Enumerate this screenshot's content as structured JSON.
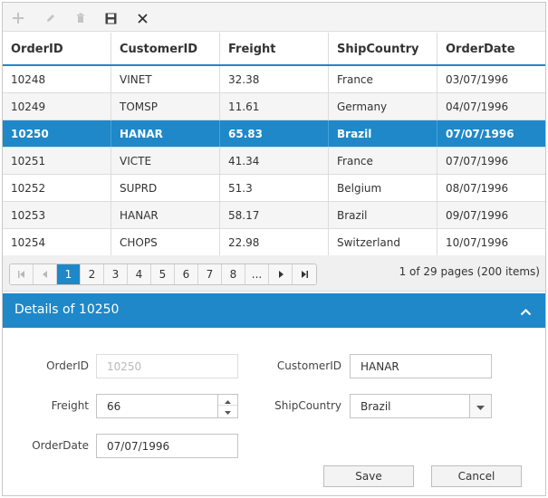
{
  "toolbar": {
    "add_icon": "plus-icon",
    "edit_icon": "pencil-icon",
    "delete_icon": "trash-icon",
    "update_icon": "save-icon",
    "cancel_icon": "close-icon"
  },
  "columns": [
    "OrderID",
    "CustomerID",
    "Freight",
    "ShipCountry",
    "OrderDate"
  ],
  "rows": [
    [
      "10248",
      "VINET",
      "32.38",
      "France",
      "03/07/1996"
    ],
    [
      "10249",
      "TOMSP",
      "11.61",
      "Germany",
      "04/07/1996"
    ],
    [
      "10250",
      "HANAR",
      "65.83",
      "Brazil",
      "07/07/1996"
    ],
    [
      "10251",
      "VICTE",
      "41.34",
      "France",
      "07/07/1996"
    ],
    [
      "10252",
      "SUPRD",
      "51.3",
      "Belgium",
      "08/07/1996"
    ],
    [
      "10253",
      "HANAR",
      "58.17",
      "Brazil",
      "09/07/1996"
    ],
    [
      "10254",
      "CHOPS",
      "22.98",
      "Switzerland",
      "10/07/1996"
    ]
  ],
  "selected_row": 2,
  "pager": {
    "pages": [
      "1",
      "2",
      "3",
      "4",
      "5",
      "6",
      "7",
      "8",
      "..."
    ],
    "current": "1",
    "info": "1 of 29 pages (200 items)"
  },
  "details": {
    "title": "Details of 10250",
    "fields": {
      "order_id": {
        "label": "OrderID",
        "value": "10250"
      },
      "customer_id": {
        "label": "CustomerID",
        "value": "HANAR"
      },
      "freight": {
        "label": "Freight",
        "value": "66"
      },
      "ship_country": {
        "label": "ShipCountry",
        "value": "Brazil"
      },
      "order_date": {
        "label": "OrderDate",
        "value": "07/07/1996"
      }
    },
    "save_label": "Save",
    "cancel_label": "Cancel"
  },
  "colors": {
    "accent": "#1e88c9",
    "selected_text": "#ffffff",
    "toolbar_icon_disabled": "#c4c4c4",
    "toolbar_icon_active": "#444444"
  }
}
